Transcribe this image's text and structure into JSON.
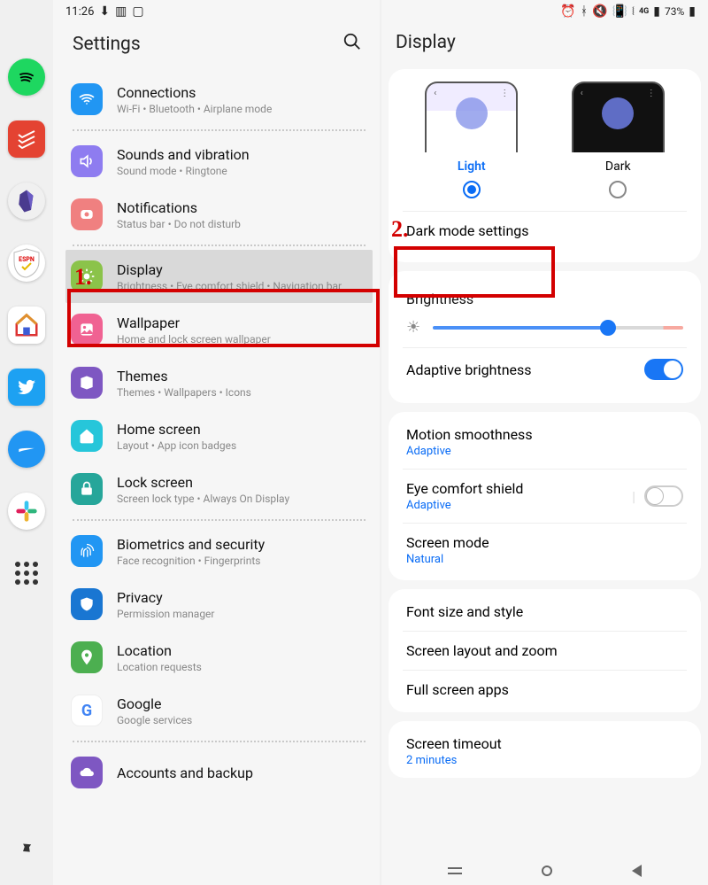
{
  "status": {
    "time": "11:26",
    "left_icons": [
      "download-icon",
      "cast-icon",
      "picture-icon"
    ],
    "right_icons": [
      "alarm-icon",
      "bluetooth-icon",
      "mute-icon",
      "vibrate-icon",
      "wifi-icon",
      "network-4g-icon",
      "signal-icon"
    ],
    "battery_text": "73%"
  },
  "left_panel": {
    "title": "Settings",
    "items": [
      {
        "key": "connections",
        "icon": "wifi-icon",
        "title": "Connections",
        "subtitle": "Wi-Fi  •  Bluetooth  •  Airplane mode"
      },
      {
        "key": "sounds",
        "icon": "volume-icon",
        "title": "Sounds and vibration",
        "subtitle": "Sound mode  •  Ringtone"
      },
      {
        "key": "notifications",
        "icon": "bell-icon",
        "title": "Notifications",
        "subtitle": "Status bar  •  Do not disturb"
      },
      {
        "key": "display",
        "icon": "sun-icon",
        "title": "Display",
        "subtitle": "Brightness  •  Eye comfort shield  •  Navigation bar",
        "selected": true
      },
      {
        "key": "wallpaper",
        "icon": "image-icon",
        "title": "Wallpaper",
        "subtitle": "Home and lock screen wallpaper"
      },
      {
        "key": "themes",
        "icon": "palette-icon",
        "title": "Themes",
        "subtitle": "Themes  •  Wallpapers  •  Icons"
      },
      {
        "key": "homescreen",
        "icon": "home-icon",
        "title": "Home screen",
        "subtitle": "Layout  •  App icon badges"
      },
      {
        "key": "lockscreen",
        "icon": "lock-icon",
        "title": "Lock screen",
        "subtitle": "Screen lock type  •  Always On Display"
      },
      {
        "key": "biometrics",
        "icon": "fingerprint-icon",
        "title": "Biometrics and security",
        "subtitle": "Face recognition  •  Fingerprints"
      },
      {
        "key": "privacy",
        "icon": "shield-icon",
        "title": "Privacy",
        "subtitle": "Permission manager"
      },
      {
        "key": "location",
        "icon": "pin-icon",
        "title": "Location",
        "subtitle": "Location requests"
      },
      {
        "key": "google",
        "icon": "google-icon",
        "title": "Google",
        "subtitle": "Google services"
      },
      {
        "key": "accounts",
        "icon": "cloud-icon",
        "title": "Accounts and backup",
        "subtitle": ""
      }
    ]
  },
  "right_panel": {
    "title": "Display",
    "theme": {
      "options": [
        {
          "key": "light",
          "label": "Light",
          "checked": true
        },
        {
          "key": "dark",
          "label": "Dark",
          "checked": false
        }
      ],
      "dark_mode_settings": "Dark mode settings"
    },
    "brightness": {
      "title": "Brightness",
      "adaptive": {
        "label": "Adaptive brightness",
        "on": true
      }
    },
    "display_settings": [
      {
        "label": "Motion smoothness",
        "sub": "Adaptive"
      },
      {
        "label": "Eye comfort shield",
        "sub": "Adaptive",
        "toggle": "off"
      },
      {
        "label": "Screen mode",
        "sub": "Natural"
      }
    ],
    "more": [
      {
        "label": "Font size and style"
      },
      {
        "label": "Screen layout and zoom"
      },
      {
        "label": "Full screen apps"
      }
    ],
    "timeout": {
      "label": "Screen timeout",
      "sub": "2 minutes"
    }
  },
  "annotations": {
    "one": "1.",
    "two": "2."
  },
  "taskbar": {
    "apps": [
      "spotify",
      "todoist",
      "obsidian",
      "espn",
      "home",
      "twitter",
      "ridge",
      "slack"
    ]
  }
}
